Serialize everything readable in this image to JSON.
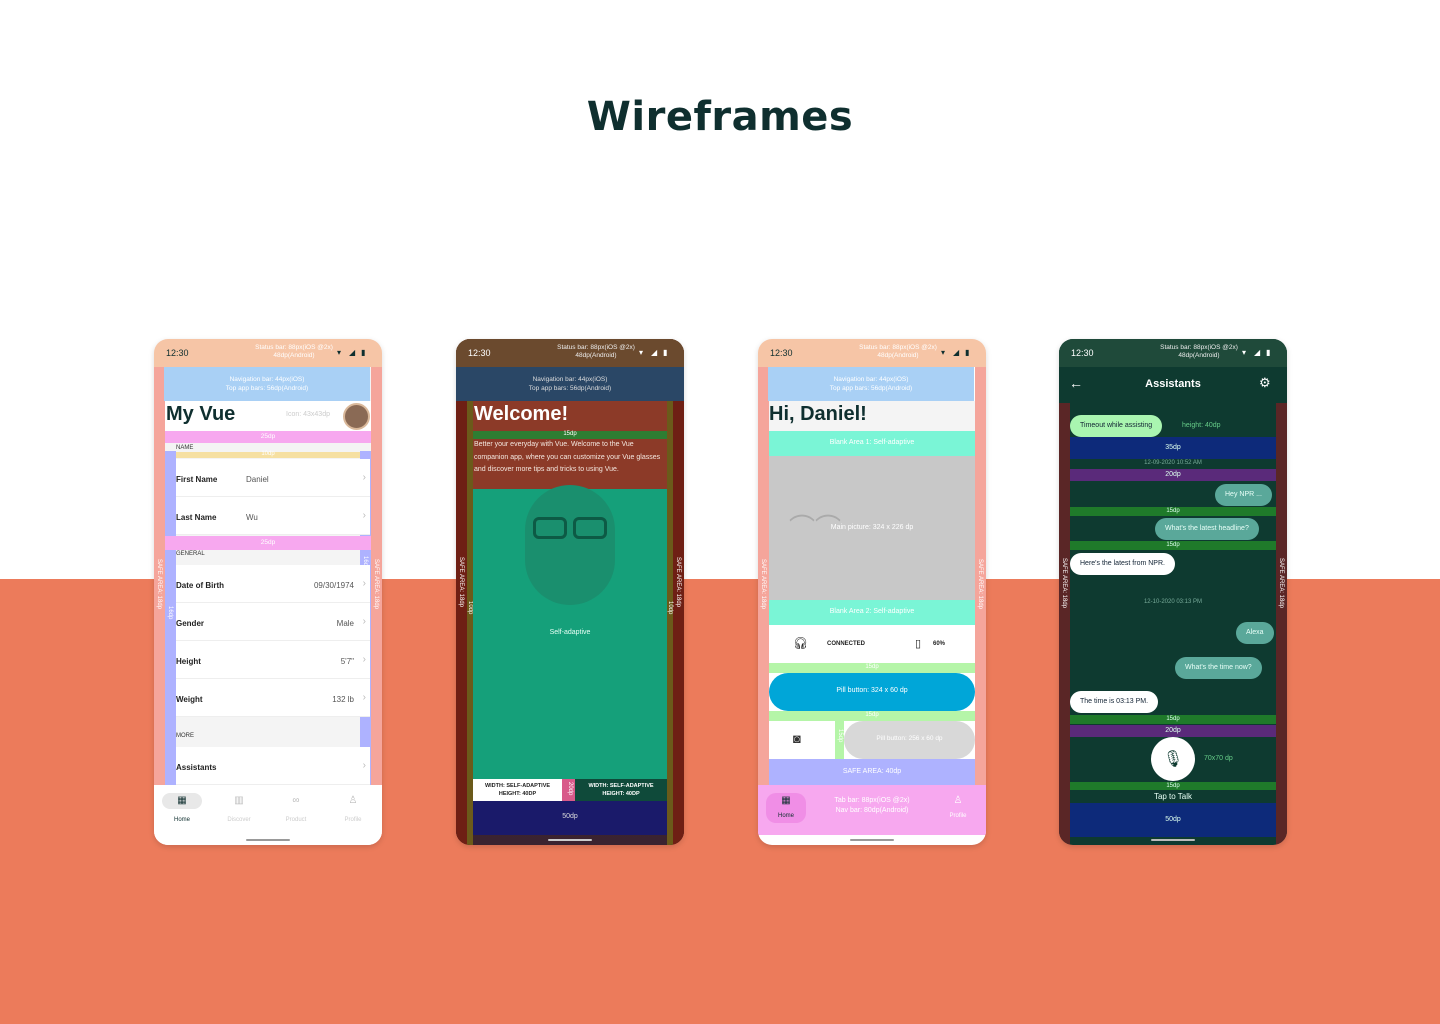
{
  "page": {
    "title": "Wireframes",
    "colors": {
      "background_top": "#ffffff",
      "background_bottom": "#ec7b5b",
      "title": "#0f2f2f"
    }
  },
  "common": {
    "time": "12:30",
    "status_note_1": "Status bar: 88px(iOS @2x)",
    "status_note_2": "48dp(Android)",
    "nav_note_1": "Navigation bar: 44px(iOS)",
    "nav_note_2": "Top app bars: 56dp(Android)",
    "safe_area_left": "SAFE AREA: 18dp",
    "safe_area_right": "SAFE AREA: 18dp",
    "margin_16": "16dp"
  },
  "phone1": {
    "title": "My Vue",
    "icon_note": "Icon: 43x43dp",
    "spacer_25": "25dp",
    "spacer_10": "10dp",
    "section_name": "NAME",
    "first_name_label": "First Name",
    "first_name_value": "Daniel",
    "last_name_label": "Last Name",
    "last_name_value": "Wu",
    "spacer_25b": "25dp",
    "section_general": "GENERAL",
    "dob_label": "Date of Birth",
    "dob_value": "09/30/1974",
    "gender_label": "Gender",
    "gender_value": "Male",
    "height_label": "Height",
    "height_value": "5'7\"",
    "weight_label": "Weight",
    "weight_value": "132 lb",
    "section_more": "MORE",
    "assistants_label": "Assistants",
    "tabs": [
      {
        "label": "Home",
        "icon": "grid-icon"
      },
      {
        "label": "Discover",
        "icon": "bar-chart-icon"
      },
      {
        "label": "Product",
        "icon": "glasses-icon"
      },
      {
        "label": "Profile",
        "icon": "person-icon"
      }
    ]
  },
  "phone2": {
    "title": "Welcome!",
    "spacer_15": "15dp",
    "body": "Better your everyday with Vue. Welcome to the Vue companion app, where you can customize your Vue glasses and discover more tips and tricks to using Vue.",
    "image_note": "Self-adaptive",
    "btn_left_1": "WIDTH: SELF-ADAPTIVE",
    "btn_left_2": "HEIGHT: 40DP",
    "gap_20": "20dp",
    "btn_right_1": "WIDTH: SELF-ADAPTIVE",
    "btn_right_2": "HEIGHT: 40DP",
    "bottom_50": "50dp",
    "side_10_left": "10dp",
    "side_10_right": "10dp"
  },
  "phone3": {
    "title": "Hi, Daniel!",
    "blank_1": "Blank Area 1: Self-adaptive",
    "main_picture": "Main picture: 324 x 226 dp",
    "blank_2": "Blank Area 2: Self-adaptive",
    "connected": "CONNECTED",
    "battery": "60%",
    "gap_15a": "15dp",
    "pill_1": "Pill button: 324 x 60 dp",
    "gap_15b": "15dp",
    "gap_15c": "15dp",
    "pill_2": "Pill button: 256 x 60 dp",
    "safe_area_bottom": "SAFE AREA: 40dp",
    "tab_note_1": "Tab bar: 88px(iOS @2x)",
    "tab_note_2": "Nav bar: 80dp(Android)",
    "tab_home": "Home",
    "tab_profile": "Profile"
  },
  "phone4": {
    "title": "Assistants",
    "msg_timeout": "Timeout while assisting",
    "height_note": "height: 40dp",
    "gap_35": "35dp",
    "date_1": "12-09-2020  10:52 AM",
    "gap_20a": "20dp",
    "msg_hey": "Hey NPR ...",
    "gap_15a": "15dp",
    "msg_headline": "What's the latest headline?",
    "gap_15b": "15dp",
    "msg_npr": "Here's the latest from NPR.",
    "date_2": "12-10-2020  03:13 PM",
    "msg_alexa": "Alexa",
    "msg_time": "What's the time now?",
    "msg_answer": "The time is 03:13 PM.",
    "gap_15c": "15dp",
    "gap_20b": "20dp",
    "mic_note": "70x70 dp",
    "gap_15d": "15dp",
    "tap_to_talk": "Tap to Talk",
    "bottom_50": "50dp"
  }
}
